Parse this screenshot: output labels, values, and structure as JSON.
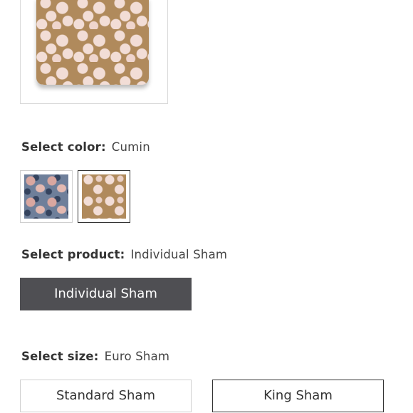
{
  "color_section": {
    "label": "Select color:",
    "selected_value": "Cumin",
    "swatches": [
      {
        "name": "Blue floral",
        "selected": false
      },
      {
        "name": "Cumin",
        "selected": true
      }
    ]
  },
  "product_section": {
    "label": "Select product:",
    "selected_value": "Individual Sham",
    "options": [
      "Individual Sham"
    ]
  },
  "size_section": {
    "label": "Select size:",
    "selected_value": "Euro Sham",
    "options": [
      "Standard Sham",
      "King Sham"
    ]
  },
  "colors": {
    "selected_button_bg": "#4f4f53",
    "text": "#333333",
    "border": "#cfcfcf"
  }
}
